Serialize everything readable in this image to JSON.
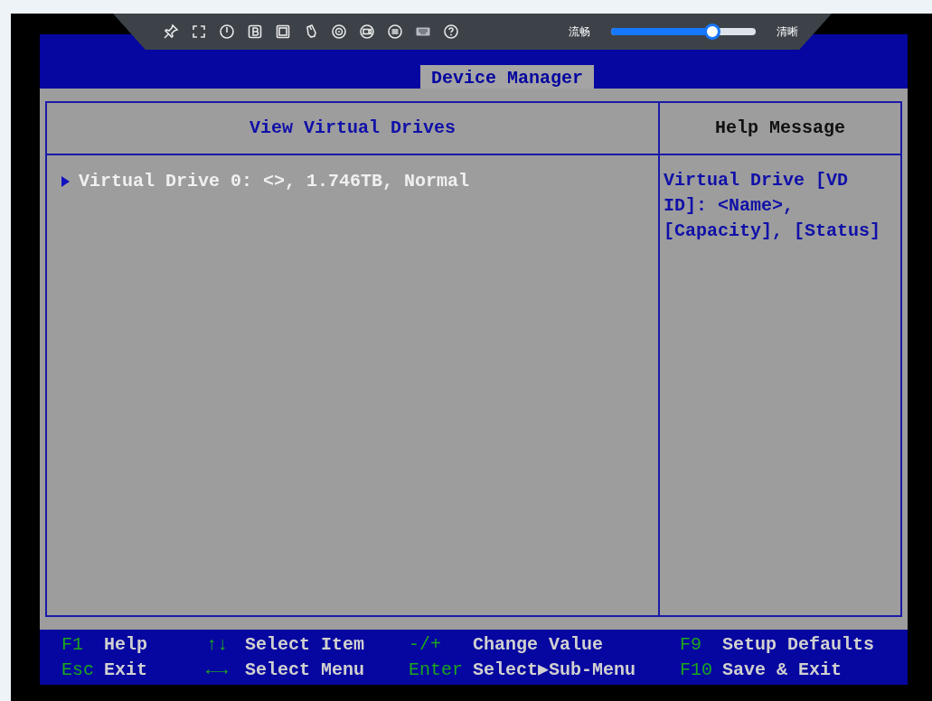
{
  "toolbar": {
    "quality_slider": {
      "left_label": "流畅",
      "right_label": "清晰",
      "level": 0.7
    }
  },
  "header": {
    "tabs": [
      {
        "label": "Device Manager",
        "selected": true
      }
    ]
  },
  "main_panel": {
    "heading": "View Virtual Drives",
    "items": [
      {
        "label": "Virtual Drive 0: <>, 1.746TB, Normal"
      }
    ]
  },
  "help_panel": {
    "heading": "Help Message",
    "text": "Virtual Drive [VD ID]: <Name>, [Capacity], [Status]"
  },
  "footer": {
    "rows": [
      [
        {
          "key": "F1",
          "action": "Help"
        },
        {
          "key": "↑↓",
          "action": "Select Item"
        },
        {
          "key": "-/+",
          "action": "Change Value"
        },
        {
          "key": "F9",
          "action": "Setup Defaults"
        }
      ],
      [
        {
          "key": "Esc",
          "action": "Exit"
        },
        {
          "key": "←→",
          "action": "Select Menu"
        },
        {
          "key": "Enter",
          "action": "Select▶Sub-Menu"
        },
        {
          "key": "F10",
          "action": "Save & Exit"
        }
      ]
    ]
  }
}
